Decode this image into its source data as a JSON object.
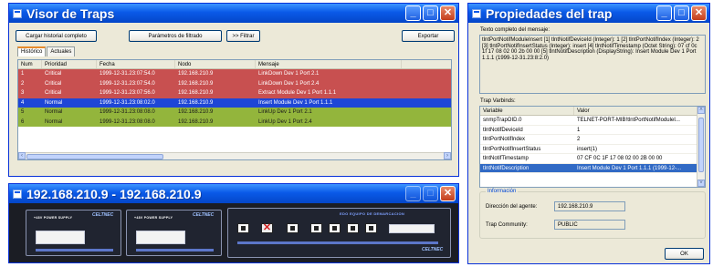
{
  "traps_window": {
    "title": "Visor de Traps",
    "buttons": {
      "load_history": "Cargar historial completo",
      "filter_params": "Parámetros de filtrado",
      "filter": ">> Filtrar",
      "export": "Exportar"
    },
    "tabs": [
      {
        "label": "Histórico",
        "active": true
      },
      {
        "label": "Actuales",
        "active": false
      }
    ],
    "columns": [
      "Num",
      "Prioridad",
      "Fecha",
      "Nodo",
      "Mensaje"
    ],
    "rows": [
      {
        "num": "1",
        "priority": "Critical",
        "date": "1999-12-31.23:07:54.0",
        "node": "192.168.210.9",
        "message": "LinkDown Dev 1 Port 2.1",
        "style": "critical"
      },
      {
        "num": "2",
        "priority": "Critical",
        "date": "1999-12-31.23:07:54.0",
        "node": "192.168.210.9",
        "message": "LinkDown Dev 1 Port 2.4",
        "style": "critical"
      },
      {
        "num": "3",
        "priority": "Critical",
        "date": "1999-12-31.23:07:56.0",
        "node": "192.168.210.9",
        "message": "Extract Module Dev 1 Port 1.1.1",
        "style": "critical"
      },
      {
        "num": "4",
        "priority": "Normal",
        "date": "1999-12-31.23:08:02.0",
        "node": "192.168.210.9",
        "message": "Insert Module Dev 1 Port 1.1.1",
        "style": "selected"
      },
      {
        "num": "5",
        "priority": "Normal",
        "date": "1999-12-31.23:08:08.0",
        "node": "192.168.210.9",
        "message": "LinkUp Dev 1 Port 2.1",
        "style": "normal"
      },
      {
        "num": "6",
        "priority": "Normal",
        "date": "1999-12-31.23:08:08.0",
        "node": "192.168.210.9",
        "message": "LinkUp Dev 1 Port 2.4",
        "style": "normal"
      }
    ]
  },
  "device_window": {
    "title": "192.168.210.9 - 192.168.210.9",
    "psu_label_1": "+48V POWER SUPPLY",
    "psu_label_2": "+48V POWER SUPPLY",
    "brand_1": "CELTNEC",
    "brand_2": "CELTNEC",
    "brand_3": "CELTNEC",
    "banner": "EDO EQUIPO DE DEMARCACION"
  },
  "props_window": {
    "title": "Propiedades del trap",
    "message_label": "Texto completo del mensaje:",
    "message_text": "tlntPortNotifModuleInsert [1] tlntNotifDeviceId (Integer): 1 [2] tlntPortNotifIndex (Integer): 2 [3] tlntPortNotifInsertStatus (Integer): insert [4] tlntNotifTimestamp (Octet String): 07 cf 0c 1f 17 08 02 00 2b 00 00 [5] tlntNotifDescription (DisplayString): Insert Module Dev 1 Port 1.1.1 (1999-12-31.23:8:2.0)",
    "varbinds_label": "Trap Varbinds:",
    "varbind_columns": [
      "Variable",
      "Valor"
    ],
    "varbinds": [
      {
        "variable": "snmpTrapOID.0",
        "value": "TELNET-PORT-MIB!tlntPortNotifModuleI...",
        "selected": false
      },
      {
        "variable": "tlntNotifDeviceId",
        "value": "1",
        "selected": false
      },
      {
        "variable": "tlntPortNotifIndex",
        "value": "2",
        "selected": false
      },
      {
        "variable": "tlntPortNotifInsertStatus",
        "value": "insert(1)",
        "selected": false
      },
      {
        "variable": "tlntNotifTimestamp",
        "value": "07 CF 0C 1F 17 08 02 00 2B 00 00",
        "selected": false
      },
      {
        "variable": "tlntNotifDescription",
        "value": "Insert Module Dev 1 Port 1.1.1 (1999-12-...",
        "selected": true
      }
    ],
    "info_group": "Información",
    "agent_label": "Dirección del agente:",
    "agent_value": "192.168.210.9",
    "community_label": "Trap Community:",
    "community_value": "PUBLIC",
    "ok_label": "OK"
  }
}
